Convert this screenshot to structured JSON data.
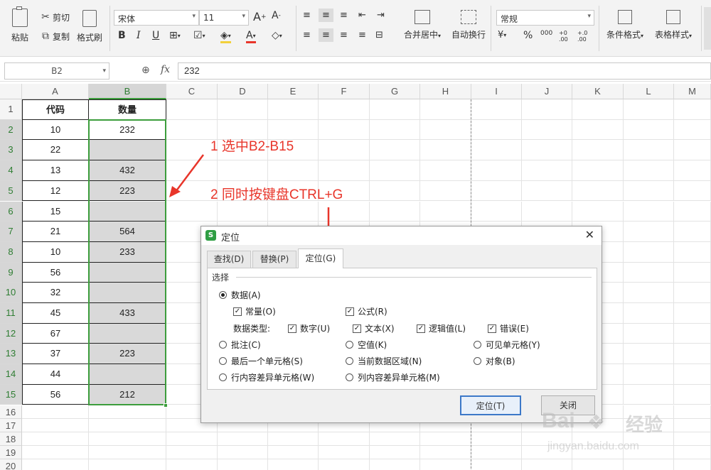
{
  "ribbon": {
    "paste": "粘贴",
    "cut": "剪切",
    "copy": "复制",
    "format_painter": "格式刷",
    "font_name": "宋体",
    "font_size": "11",
    "merge_center": "合并居中",
    "wrap_text": "自动换行",
    "number_format": "常规",
    "cond_format": "条件格式",
    "table_style": "表格样式",
    "percent": "%",
    "thousands": "000",
    "dec_inc": "+0 .00",
    "dec_dec": "+.0 .00"
  },
  "formula_bar": {
    "name_box": "B2",
    "fx": "fx",
    "value": "232"
  },
  "columns": [
    "A",
    "B",
    "C",
    "D",
    "E",
    "F",
    "G",
    "H",
    "I",
    "J",
    "K",
    "L",
    "M"
  ],
  "rows": [
    "1",
    "2",
    "3",
    "4",
    "5",
    "6",
    "7",
    "8",
    "9",
    "10",
    "11",
    "12",
    "13",
    "14",
    "15",
    "16",
    "17",
    "18",
    "19",
    "20"
  ],
  "sheet": {
    "header_a": "代码",
    "header_b": "数量",
    "col_a": [
      "10",
      "22",
      "13",
      "12",
      "15",
      "21",
      "10",
      "56",
      "32",
      "45",
      "67",
      "37",
      "44",
      "56"
    ],
    "col_b": [
      "232",
      "",
      "432",
      "223",
      "",
      "564",
      "233",
      "",
      "",
      "433",
      "",
      "223",
      "",
      "212"
    ]
  },
  "annotations": {
    "step1": "1 选中B2-B15",
    "step2": "2 同时按键盘CTRL+G"
  },
  "dialog": {
    "title": "定位",
    "tabs": [
      "查找(D)",
      "替换(P)",
      "定位(G)"
    ],
    "group": "选择",
    "data": "数据(A)",
    "constant": "常量(O)",
    "formula": "公式(R)",
    "data_type": "数据类型:",
    "number": "数字(U)",
    "text": "文本(X)",
    "logical": "逻辑值(L)",
    "error": "错误(E)",
    "comment": "批注(C)",
    "blank": "空值(K)",
    "visible": "可见单元格(Y)",
    "last_cell": "最后一个单元格(S)",
    "current_region": "当前数据区域(N)",
    "object": "对象(B)",
    "row_diff": "行内容差异单元格(W)",
    "col_diff": "列内容差异单元格(M)",
    "ok": "定位(T)",
    "close": "关闭"
  },
  "watermark": {
    "brand": "Bai",
    "brand2": "经验",
    "url": "jingyan.baidu.com"
  },
  "colors": {
    "selection_border": "#3c9d3c",
    "selection_fill": "#d9d9d9",
    "annotation": "#e8352a",
    "dialog_ok_border": "#3c78c8"
  }
}
